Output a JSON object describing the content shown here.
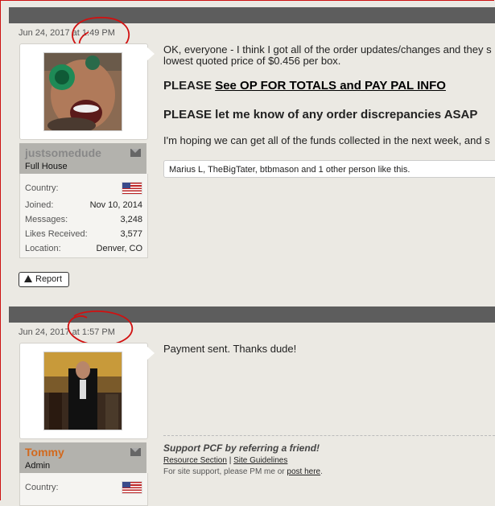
{
  "posts": [
    {
      "date": "Jun 24, 2017 at 1:49 PM",
      "username": "justsomedude",
      "user_title": "Full House",
      "stats": {
        "country_label": "Country:",
        "joined_label": "Joined:",
        "joined": "Nov 10, 2014",
        "messages_label": "Messages:",
        "messages": "3,248",
        "likes_label": "Likes Received:",
        "likes": "3,577",
        "location_label": "Location:",
        "location": "Denver, CO"
      },
      "report_label": "Report",
      "body": {
        "line1": "OK, everyone - I think I got all of the order updates/changes and they s",
        "line2": "lowest quoted price of $0.456 per box.",
        "please1_prefix": "PLEASE ",
        "please1_link": "See OP FOR TOTALS and PAY PAL INFO",
        "please2": "PLEASE let me know of any order discrepancies ASAP",
        "line3": "I'm hoping we can get all of the funds collected in the next week, and s"
      },
      "likes_text": "Marius L, TheBigTater, btbmason and 1 other person like this."
    },
    {
      "date": "Jun 24, 2017 at 1:57 PM",
      "username": "Tommy",
      "user_title": "Admin",
      "stats": {
        "country_label": "Country:"
      },
      "body": {
        "line1": "Payment sent. Thanks dude!"
      },
      "signature": {
        "line1": "Support PCF by referring a friend!",
        "link1": "Resource Section",
        "sep": "|",
        "link2": "Site Guidelines",
        "line3_prefix": "For site support, please PM me or",
        "line3_link": "post here",
        "line3_suffix": "."
      }
    }
  ],
  "colors": {
    "accent_username_1": "#888888",
    "accent_username_2": "#d2691e",
    "bar": "#5d5d5d",
    "annotation_red": "#d11111"
  }
}
